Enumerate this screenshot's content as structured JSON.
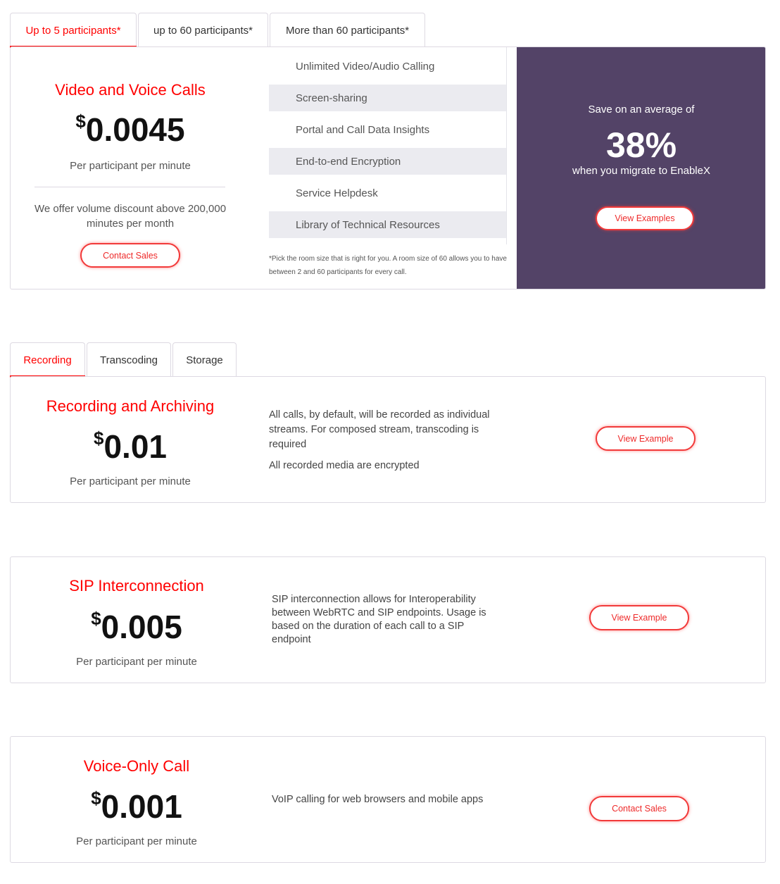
{
  "pricing_tabs": [
    {
      "label": "Up to 5 participants*",
      "active": true
    },
    {
      "label": "up to 60 participants*",
      "active": false
    },
    {
      "label": "More than 60 participants*",
      "active": false
    }
  ],
  "video_voice": {
    "title": "Video and Voice Calls",
    "currency": "$",
    "price": "0.0045",
    "unit": "Per participant per minute",
    "volume_note": "We offer volume discount above 200,000 minutes per month",
    "button_label": "Contact Sales"
  },
  "features": [
    "Unlimited Video/Audio Calling",
    "Screen-sharing",
    "Portal and Call Data Insights",
    "End-to-end Encryption",
    "Service Helpdesk",
    "Library of Technical Resources"
  ],
  "footnote": "*Pick the room size that is right for you. A room size of 60 allows you to have between 2 and 60 participants for every call.",
  "savings": {
    "intro": "Save on an average of",
    "percent": "38%",
    "outro": "when you migrate to EnableX",
    "button_label": "View Examples",
    "bg_color": "#534367"
  },
  "media_tabs": [
    {
      "label": "Recording",
      "active": true
    },
    {
      "label": "Transcoding",
      "active": false
    },
    {
      "label": "Storage",
      "active": false
    }
  ],
  "recording": {
    "title": "Recording and Archiving",
    "currency": "$",
    "price": "0.01",
    "unit": "Per participant per minute",
    "description": "All calls, by default, will be recorded as individual streams. For composed stream, transcoding is required",
    "description2": "All recorded media are encrypted",
    "button_label": "View Example"
  },
  "sip": {
    "title": "SIP Interconnection",
    "currency": "$",
    "price": "0.005",
    "unit": "Per participant per minute",
    "description": "SIP interconnection allows for Interoperability between WebRTC and SIP endpoints. Usage is based on the duration of each call to a SIP endpoint",
    "button_label": "View Example"
  },
  "voice_only": {
    "title": "Voice-Only Call",
    "currency": "$",
    "price": "0.001",
    "unit": "Per participant per minute",
    "description": "VoIP calling for web browsers and mobile apps",
    "button_label": "Contact Sales"
  },
  "colors": {
    "accent_red": "#ff0000",
    "purple_panel": "#534367"
  }
}
